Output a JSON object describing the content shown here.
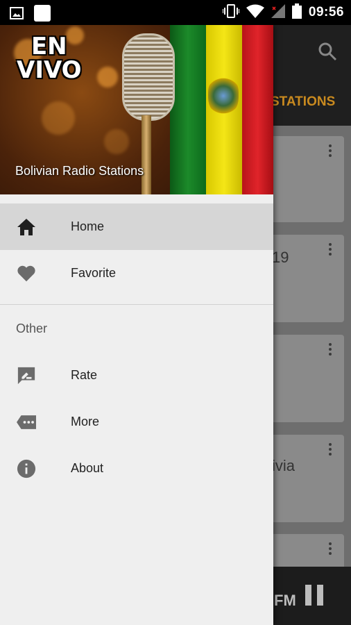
{
  "status_bar": {
    "time": "09:56",
    "icons": [
      "image-icon",
      "app-square-icon",
      "vibrate-icon",
      "wifi-icon",
      "signal-icon",
      "battery-icon"
    ]
  },
  "background_app": {
    "tab_partial": "STATIONS",
    "card_texts": [
      "19",
      "ivia"
    ],
    "player_text_partial": "FM",
    "icons": [
      "search-icon",
      "more-vert-icon",
      "pause-icon"
    ]
  },
  "drawer": {
    "header": {
      "badge_line1": "EN",
      "badge_line2": "VIVO",
      "title": "Bolivian Radio Stations"
    },
    "primary_items": [
      {
        "label": "Home",
        "icon": "home-icon",
        "active": true
      },
      {
        "label": "Favorite",
        "icon": "heart-icon",
        "active": false
      }
    ],
    "section_title": "Other",
    "secondary_items": [
      {
        "label": "Rate",
        "icon": "rate-review-icon"
      },
      {
        "label": "More",
        "icon": "more-tag-icon"
      },
      {
        "label": "About",
        "icon": "info-icon"
      }
    ]
  },
  "colors": {
    "accent": "#c98a1f",
    "drawer_bg": "#efefef",
    "active_item_bg": "#d6d6d6",
    "icon_color": "#6b6b6b"
  }
}
